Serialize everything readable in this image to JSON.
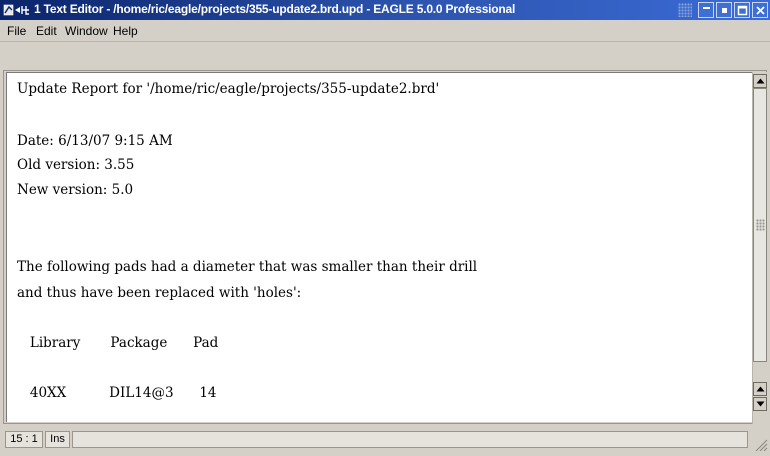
{
  "window": {
    "title": "1 Text Editor - /home/ric/eagle/projects/355-update2.brd.upd - EAGLE 5.0.0 Professional",
    "icon": "eagle-app-icon",
    "buttons": [
      "minimize-icon",
      "restore-icon",
      "maximize-icon",
      "close-icon"
    ],
    "title_bar_color": "#0a246a"
  },
  "menu": {
    "items": [
      "File",
      "Edit",
      "Window",
      "Help"
    ]
  },
  "editor": {
    "lines": [
      "Update Report for '/home/ric/eagle/projects/355-update2.brd'",
      "",
      "Date: 6/13/07 9:15 AM",
      "Old version: 3.55",
      "New version: 5.0",
      "",
      "",
      "",
      "The following pads had a diameter that was smaller than their drill",
      "and thus have been replaced with 'holes':",
      "",
      "   Library       Package      Pad",
      "",
      "   40XX          DIL14@3      14"
    ]
  },
  "statusbar": {
    "cursor_position": "15 : 1",
    "insert_mode": "Ins",
    "message": ""
  }
}
